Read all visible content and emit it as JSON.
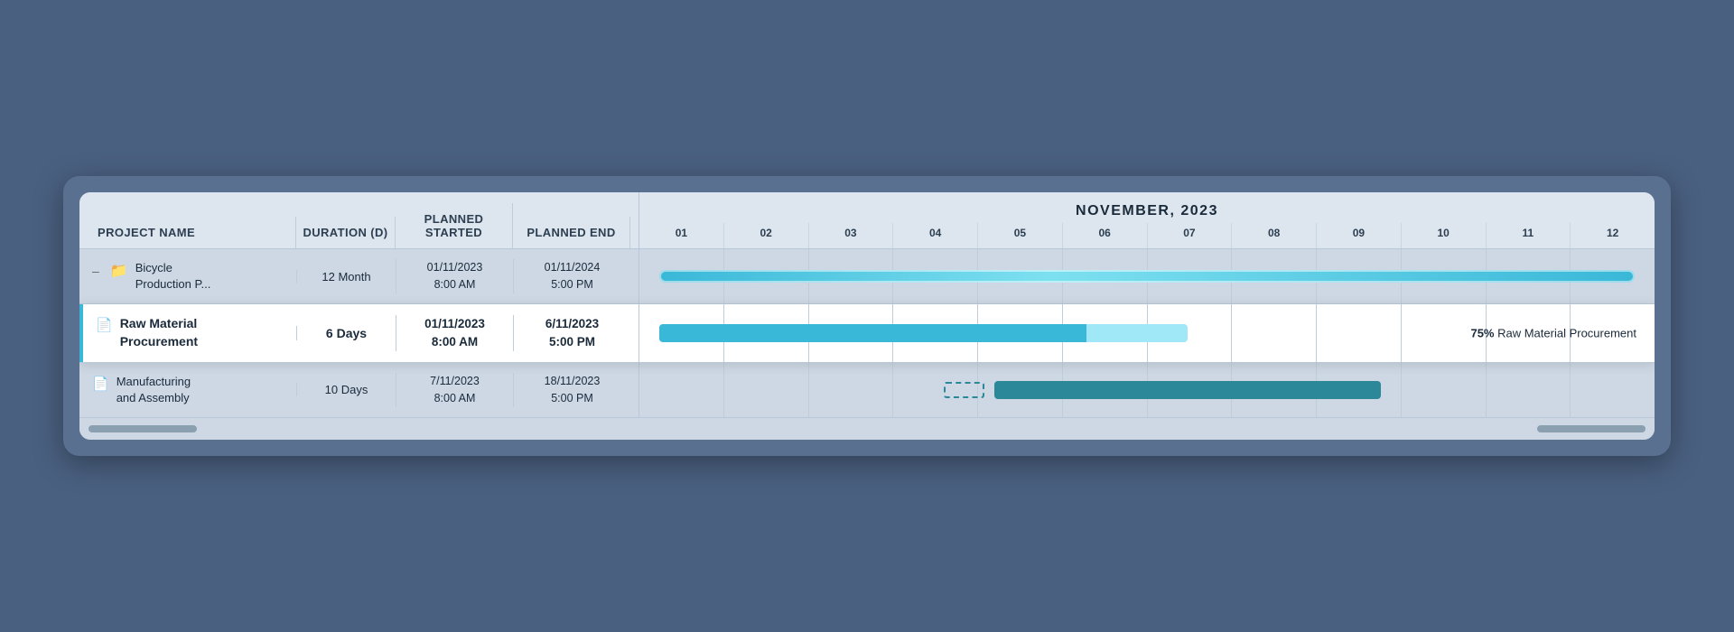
{
  "header": {
    "month_title": "NOVEMBER, 2023",
    "cols": {
      "project_name": "PROJECT NAME",
      "duration": "DURATION (D)",
      "planned_start": "PLANNED STARTED",
      "planned_end": "PLANNED END"
    },
    "days": [
      "01",
      "02",
      "03",
      "04",
      "05",
      "06",
      "07",
      "08",
      "09",
      "10",
      "11",
      "12"
    ]
  },
  "rows": [
    {
      "id": "bicycle",
      "icon": "folder",
      "collapse": "–",
      "name_line1": "Bicycle",
      "name_line2": "Production P...",
      "duration": "12 Month",
      "planned_start": "01/11/2023\n8:00 AM",
      "planned_end": "01/11/2024\n5:00 PM",
      "highlighted": false,
      "bar_type": "bicycle"
    },
    {
      "id": "raw-material",
      "icon": "doc",
      "collapse": "",
      "name_line1": "Raw Material",
      "name_line2": "Procurement",
      "duration": "6 Days",
      "planned_start": "01/11/2023\n8:00 AM",
      "planned_end": "6/11/2023\n5:00 PM",
      "highlighted": true,
      "bar_type": "raw_material",
      "progress_label": "75% Raw Material Procurement"
    },
    {
      "id": "manufacturing",
      "icon": "doc",
      "collapse": "",
      "name_line1": "Manufacturing",
      "name_line2": "and Assembly",
      "duration": "10 Days",
      "planned_start": "7/11/2023\n8:00 AM",
      "planned_end": "18/11/2023\n5:00 PM",
      "highlighted": false,
      "bar_type": "manufacturing"
    }
  ],
  "colors": {
    "bar_bicycle": "#3ab8d8",
    "bar_bicycle_light": "#7de0f0",
    "bar_raw_filled": "#3ab8d8",
    "bar_raw_light": "#a0e8f8",
    "bar_manufacturing": "#2a8899",
    "bar_dashed": "#2a8899",
    "accent": "#3ab8d8",
    "highlight_border": "#3ab8d8",
    "text_dark": "#1a2a3a",
    "bg_normal": "#cdd8e4",
    "bg_header": "#dde6ef",
    "bg_highlight": "#ffffff",
    "grid_border": "#c0cdd8"
  }
}
